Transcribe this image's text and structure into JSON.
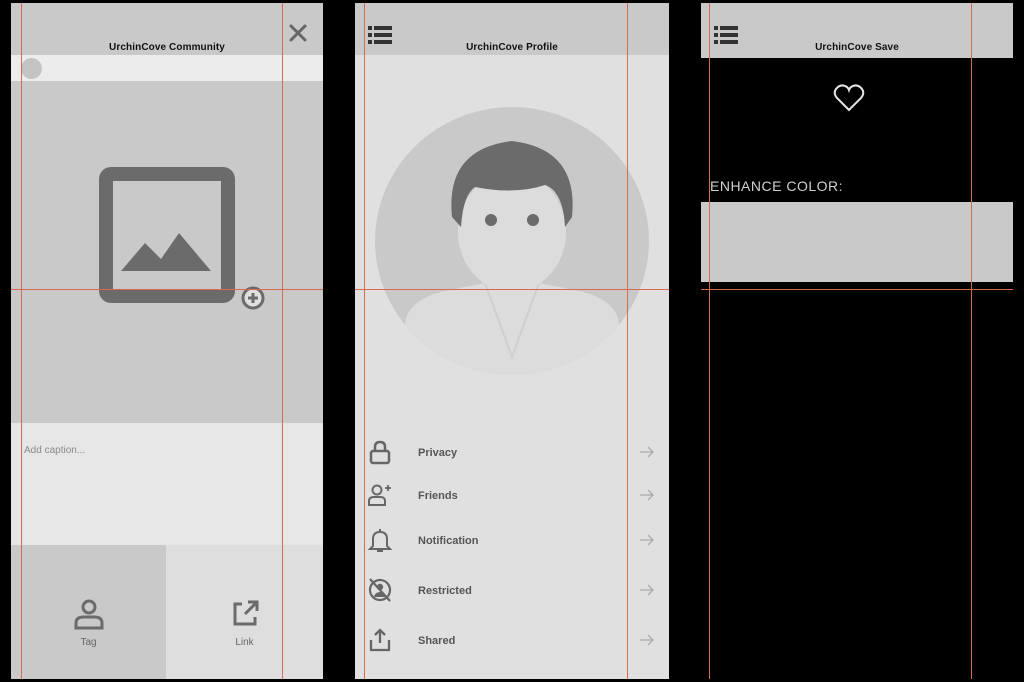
{
  "screens": {
    "community": {
      "title": "UrchinCove Community",
      "caption_placeholder": "Add caption...",
      "actions": [
        {
          "label": "Tag",
          "icon": "user-icon"
        },
        {
          "label": "Link",
          "icon": "external-link-icon"
        }
      ]
    },
    "profile": {
      "title": "UrchinCove Profile",
      "menu": [
        {
          "label": "Privacy",
          "icon": "lock-icon"
        },
        {
          "label": "Friends",
          "icon": "add-friend-icon"
        },
        {
          "label": "Notification",
          "icon": "bell-icon"
        },
        {
          "label": "Restricted",
          "icon": "restricted-icon"
        },
        {
          "label": "Shared",
          "icon": "share-icon"
        }
      ]
    },
    "save": {
      "title": "UrchinCove Save",
      "enhance_label": "ENHANCE COLOR:"
    }
  },
  "colors": {
    "guide": "#d76a50",
    "header": "#c9c9c9",
    "panel": "#e0e0e0",
    "icon": "#6b6b6b"
  }
}
